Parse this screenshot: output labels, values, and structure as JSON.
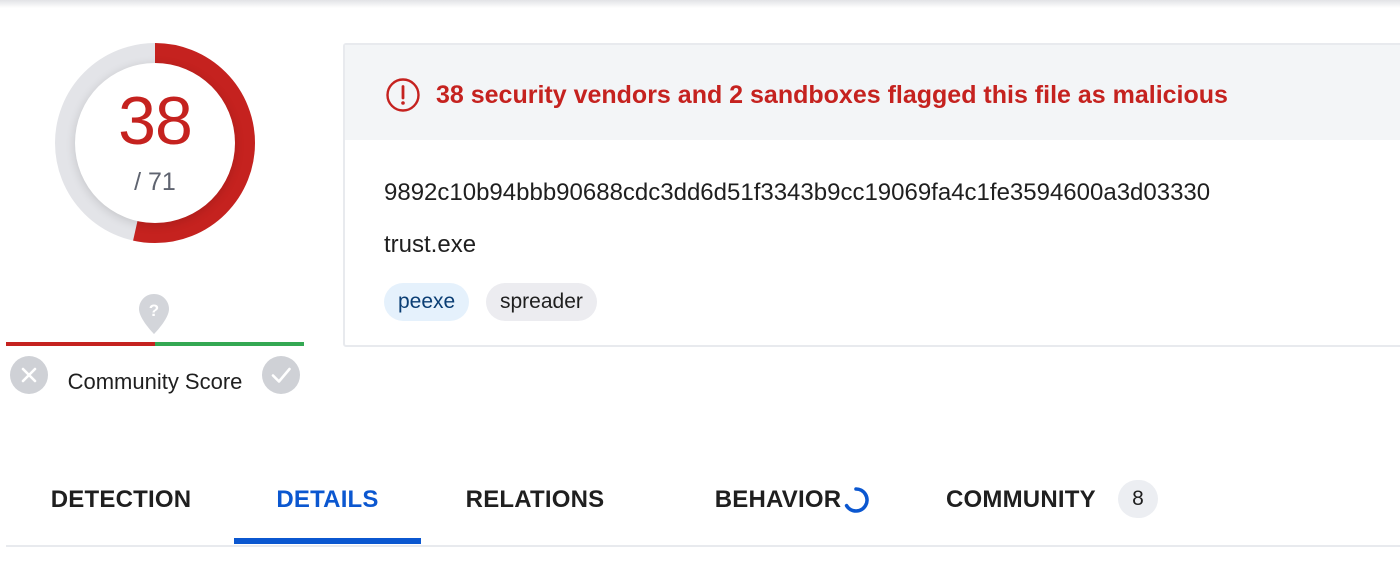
{
  "score": {
    "detections": "38",
    "total": "/ 71",
    "detection_fraction": 0.535,
    "color": "#c5221f"
  },
  "community": {
    "label": "Community Score",
    "unknown_icon": "question-pin-icon",
    "negative_color": "#c5221f",
    "positive_color": "#34a853"
  },
  "alert": {
    "icon": "exclamation-circle-icon",
    "text": "38 security vendors and 2 sandboxes flagged this file as malicious"
  },
  "file": {
    "hash": "9892c10b94bbb90688cdc3dd6d51f3343b9cc19069fa4c1fe3594600a3d03330",
    "name": "trust.exe",
    "tags": [
      "peexe",
      "spreader"
    ]
  },
  "tabs": [
    {
      "label": "DETECTION"
    },
    {
      "label": "DETAILS",
      "active": true
    },
    {
      "label": "RELATIONS"
    },
    {
      "label": "BEHAVIOR",
      "loading": true
    },
    {
      "label": "COMMUNITY",
      "badge": "8"
    }
  ],
  "colors": {
    "accent": "#0b57d0",
    "malicious": "#c5221f"
  }
}
